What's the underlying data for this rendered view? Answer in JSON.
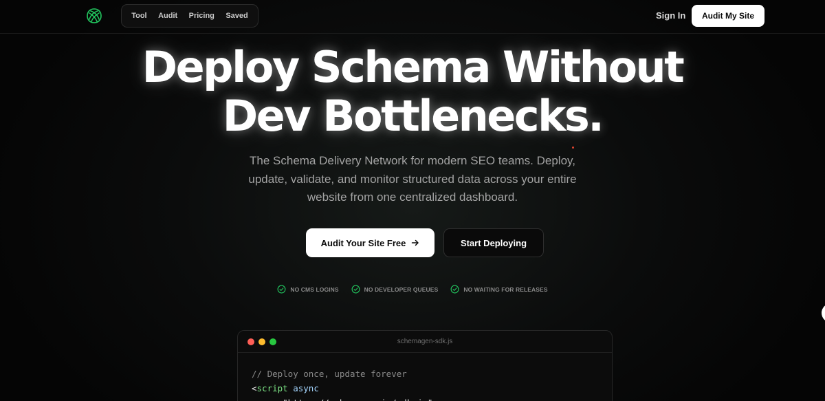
{
  "nav": {
    "links": [
      "Tool",
      "Audit",
      "Pricing",
      "Saved"
    ],
    "sign_in": "Sign In",
    "cta": "Audit My Site"
  },
  "hero": {
    "headline_line1": "Deploy Schema Without",
    "headline_line2": "Dev Bottlenecks.",
    "subhead": "The Schema Delivery Network for modern SEO teams. Deploy, update, validate, and monitor structured data across your entire website from one centralized dashboard.",
    "primary_cta": "Audit Your Site Free",
    "secondary_cta": "Start Deploying",
    "features": [
      "NO CMS LOGINS",
      "NO DEVELOPER QUEUES",
      "NO WAITING FOR RELEASES"
    ]
  },
  "code": {
    "filename": "schemagen-sdk.js",
    "line1": "// Deploy once, update forever",
    "line2_tag": "<",
    "line2_kw": "script",
    "line2_attr": " async",
    "line3": "  src=\"https://schemagen.io/sdk.js\""
  },
  "colors": {
    "accent_green": "#22c55e",
    "background": "#050505",
    "button_light": "#ffffff"
  },
  "icons": {
    "logo": "knot-logo-icon",
    "arrow": "arrow-right-icon",
    "check": "check-circle-icon"
  }
}
